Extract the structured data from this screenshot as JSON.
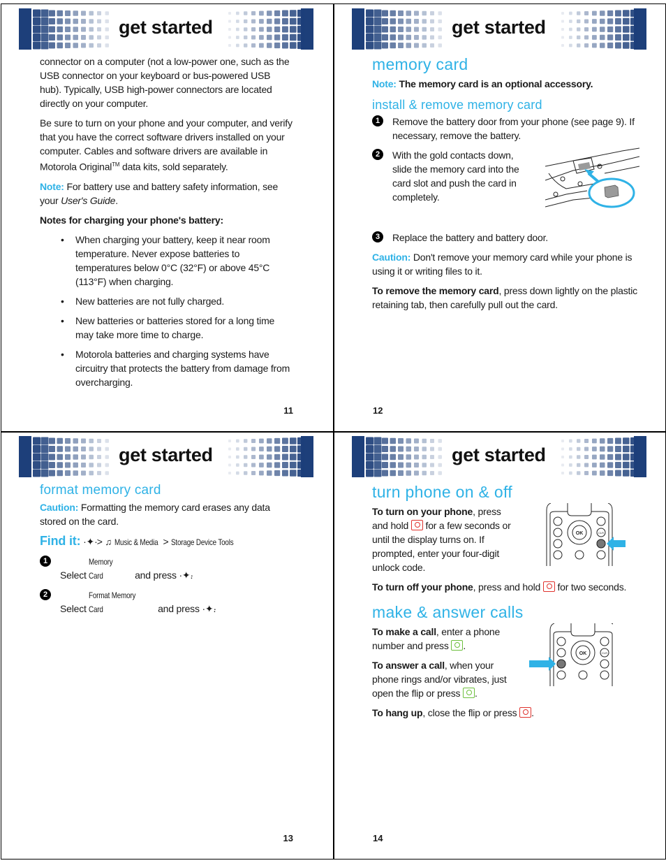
{
  "section_title": "get started",
  "colors": {
    "accent": "#2fb2e6",
    "banner_dark": "#1d3f7a",
    "power_key": "#e0322d",
    "send_key": "#6cbf3c"
  },
  "pages": {
    "p11": {
      "page_number": "11",
      "para1": "connector on a computer (not a low-power one, such as the USB connector on your keyboard or bus-powered USB hub). Typically, USB high-power connectors are located directly on your computer.",
      "para2_a": "Be sure to turn on your phone and your computer, and verify that you have the correct software drivers installed on your computer. Cables and software drivers are available in Motorola Original",
      "para2_tm": "TM",
      "para2_b": " data kits, sold separately.",
      "note_label": "Note:",
      "note_text": " For battery use and battery safety information, see your ",
      "note_italic": "User's Guide",
      "note_end": ".",
      "notes_heading": "Notes for charging your phone's battery:",
      "bullets": [
        "When charging your battery, keep it near room temperature. Never expose batteries to temperatures below 0°C  (32°F) or above 45°C (113°F) when charging.",
        "New batteries are not fully charged.",
        "New batteries or batteries stored for a long time may take more time to charge.",
        "Motorola batteries and charging systems have circuitry that protects the battery from damage from overcharging."
      ]
    },
    "p12": {
      "page_number": "12",
      "heading": "memory card",
      "note_label": "Note:",
      "note_text": " The memory card is an optional accessory.",
      "subheading": "install & remove memory card",
      "steps": [
        {
          "num": "1",
          "text": "Remove the battery door from your phone (see page 9). If necessary, remove the battery."
        },
        {
          "num": "2",
          "text": "With the gold contacts down, slide the memory card into the card slot and push the card in completely."
        },
        {
          "num": "3",
          "text": "Replace the battery and battery door."
        }
      ],
      "caution_label": "Caution:",
      "caution_text": " Don't remove your memory card while your phone is using it or writing files to it.",
      "remove_bold": "To remove the memory card",
      "remove_text": ", press down lightly on the plastic retaining tab, then carefully pull out the card."
    },
    "p13": {
      "page_number": "13",
      "heading": "format memory card",
      "caution_label": "Caution:",
      "caution_text": " Formatting the memory card erases any data stored on the card.",
      "findit_label": "Find it:",
      "nav_key": "·✦·",
      "sep": ">",
      "menu_path": [
        "Music & Media",
        "Storage Device Tools"
      ],
      "steps": [
        {
          "num": "1",
          "pre": "Select ",
          "item": "Memory Card",
          "post": " and press "
        },
        {
          "num": "2",
          "pre": "Select ",
          "item": "Format Memory Card",
          "post": " and press "
        }
      ]
    },
    "p14": {
      "page_number": "14",
      "heading1": "turn phone on & off",
      "on_bold": "To turn on your phone",
      "on_text_a": ", press and hold ",
      "on_text_b": " for a few seconds or until the display turns on. If prompted, enter your four-digit unlock code.",
      "off_bold": "To turn off your phone",
      "off_text_a": ", press and hold ",
      "off_text_b": " for two seconds.",
      "heading2": "make & answer calls",
      "make_bold": "To make a call",
      "make_text_a": ", enter a phone number and press ",
      "make_text_b": ".",
      "answer_bold": "To answer a call",
      "answer_text_a": ", when your phone rings and/or vibrates, just open the flip or press ",
      "answer_text_b": ".",
      "hang_bold": "To hang up",
      "hang_text_a": ", close the flip or press ",
      "hang_text_b": ".",
      "keypad_labels": {
        "ok": "OK",
        "clr": "CLR"
      }
    }
  }
}
